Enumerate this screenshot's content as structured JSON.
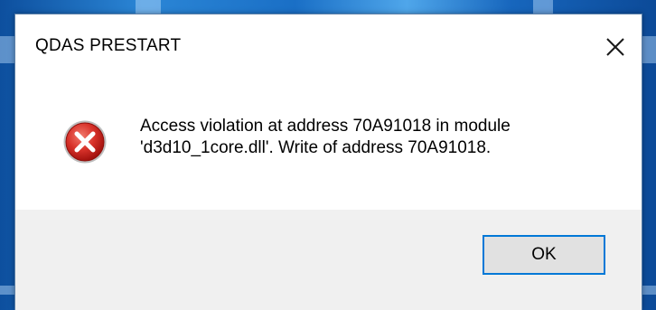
{
  "window": {
    "title": "QDAS PRESTART",
    "close_symbol": "close-icon"
  },
  "dialog": {
    "icon": "error-icon",
    "message_line1": "Access violation at address 70A91018 in module",
    "message_line2": "'d3d10_1core.dll'. Write of address 70A91018.",
    "ok_label": "OK"
  },
  "colors": {
    "error_red": "#d32f2f",
    "button_border": "#0078d7",
    "footer_bg": "#f0f0f0",
    "desktop_blue": "#1a67b8"
  }
}
